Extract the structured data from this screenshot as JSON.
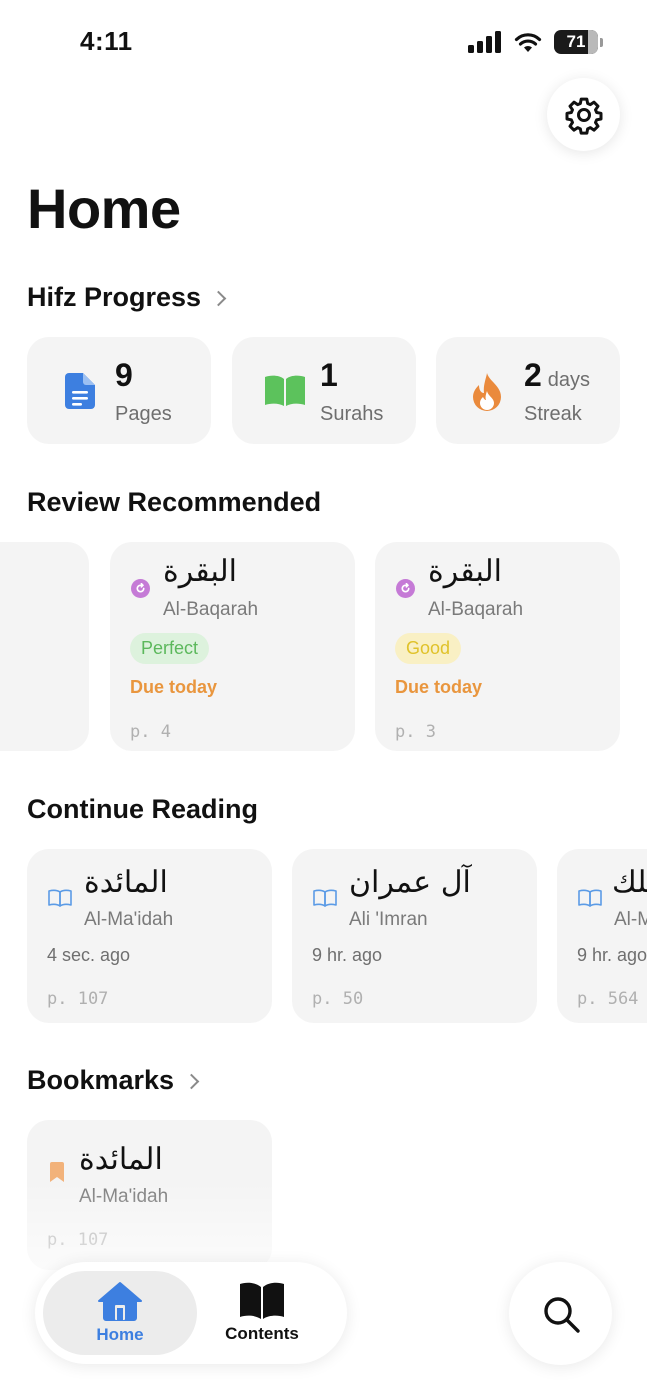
{
  "status": {
    "time": "4:11",
    "battery": "71",
    "battery_level": 71
  },
  "page_title": "Home",
  "sections": {
    "hifz": "Hifz Progress",
    "review": "Review Recommended",
    "continue": "Continue Reading",
    "bookmarks": "Bookmarks"
  },
  "stats": [
    {
      "value": "9",
      "unit": "",
      "label": "Pages",
      "icon": "document-icon",
      "color": "#3d7fe0"
    },
    {
      "value": "1",
      "unit": "",
      "label": "Surahs",
      "icon": "open-book-icon",
      "color": "#5cc25c"
    },
    {
      "value": "2",
      "unit": "days",
      "label": "Streak",
      "icon": "flame-icon",
      "color": "#ea8a3c"
    }
  ],
  "review_cards": [
    {
      "arabic": "البقرة",
      "name": "Al-Baqarah",
      "status": "Perfect",
      "due": "Due today",
      "page": "p. 4"
    },
    {
      "arabic": "البقرة",
      "name": "Al-Baqarah",
      "status": "Good",
      "due": "Due today",
      "page": "p. 3"
    }
  ],
  "continue_cards": [
    {
      "arabic": "المائدة",
      "name": "Al-Ma'idah",
      "ago": "4 sec. ago",
      "page": "p. 107"
    },
    {
      "arabic": "آل عمران",
      "name": "Ali 'Imran",
      "ago": "9 hr. ago",
      "page": "p. 50"
    },
    {
      "arabic": "الملك",
      "name": "Al-M",
      "ago": "9 hr. ago",
      "page": "p. 564"
    }
  ],
  "bookmark_cards": [
    {
      "arabic": "المائدة",
      "name": "Al-Ma'idah",
      "page": "p. 107"
    }
  ],
  "tabs": {
    "home": "Home",
    "contents": "Contents"
  },
  "colors": {
    "accent": "#3d7fe0",
    "perfect_bg": "#ddf2dd",
    "perfect_text": "#5cb85c",
    "good_bg": "#f9f0c4",
    "good_text": "#e0c22a",
    "due": "#e9963e",
    "review_icon": "#c57ad6",
    "read_icon": "#5b9be6",
    "bookmark_icon": "#f2b27a"
  }
}
